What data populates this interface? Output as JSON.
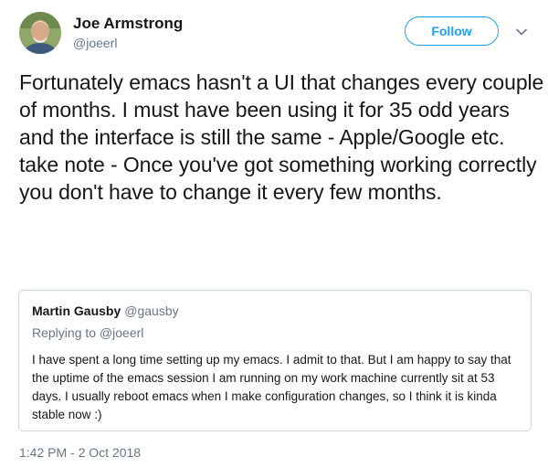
{
  "tweet": {
    "author": {
      "name": "Joe Armstrong",
      "handle": "@joeerl"
    },
    "follow_label": "Follow",
    "text": "Fortunately emacs hasn't a UI that changes every couple of months. I must have been using it for 35 odd years and the interface is still the same - Apple/Google etc. take note - Once you've got something working correctly you don't have to change it every few months.",
    "timestamp": "1:42 PM - 2 Oct 2018"
  },
  "quoted": {
    "author_name": "Martin Gausby",
    "author_handle": "@gausby",
    "replying_prefix": "Replying to",
    "replying_to": "@joeerl",
    "text": "I have spent a long time setting up my emacs. I admit to that. But I am happy to say that the uptime of the emacs session I am running on my work machine currently sit at 53 days. I usually reboot emacs when I make configuration changes, so I think it is kinda stable now :)"
  },
  "colors": {
    "accent": "#1da1f2",
    "secondary_text": "#657786",
    "border": "#ccd6dd"
  },
  "icons": {
    "more": "chevron-down-icon",
    "avatar": "avatar"
  }
}
